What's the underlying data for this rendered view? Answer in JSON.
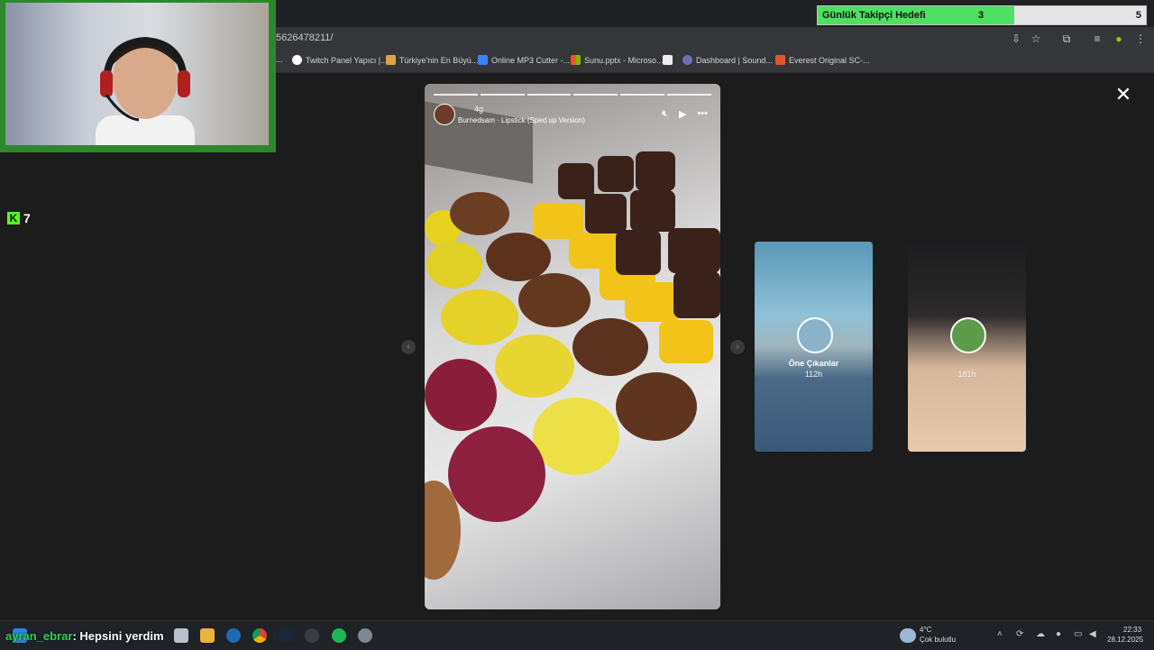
{
  "overlay": {
    "goal": {
      "title": "Günlük Takipçi Hedefi",
      "current": "3",
      "target": "5",
      "progress": 0.6
    },
    "kick": {
      "logo": "K",
      "viewers": "7"
    },
    "chat": {
      "user": "ayran_ebrar",
      "message": ": Hepsini yerdim"
    }
  },
  "browser": {
    "url": "5626478211/",
    "bookmarks": [
      {
        "label": "...",
        "icon": "generic-icon"
      },
      {
        "label": "Twitch Panel Yapıcı |...",
        "icon": "twitch-panel-icon"
      },
      {
        "label": "Türkiye'nin En Büyü...",
        "icon": "crown-icon"
      },
      {
        "label": "Online MP3 Cutter -...",
        "icon": "mp3-cutter-icon"
      },
      {
        "label": "Sunu.pptx - Microso...",
        "icon": "microsoft-icon"
      },
      {
        "label": "",
        "icon": "page-icon"
      },
      {
        "label": "Dashboard | Sound...",
        "icon": "soundcloud-icon"
      },
      {
        "label": "Everest Original SC-...",
        "icon": "hb-icon"
      }
    ]
  },
  "story": {
    "age": "4g",
    "song": "Burnedsam · Lipstick (Sped up Version)",
    "segments": 6,
    "controls": {
      "mute": "mute-icon",
      "play": "play-icon",
      "more": "•••"
    }
  },
  "cards": [
    {
      "label": "Öne Çıkanlar",
      "sub": "112h"
    },
    {
      "label": "",
      "sub": "181h"
    }
  ],
  "taskbar": {
    "weather": {
      "temp": "4°C",
      "desc": "Çok bulutlu"
    },
    "clock": {
      "time": "22:33",
      "date": "28.12.2025"
    }
  },
  "colors": {
    "goal_fill": "#4ee060",
    "cam_border": "#2a8a2a",
    "kick_green": "#53fc18",
    "chat_user": "#34d058"
  }
}
